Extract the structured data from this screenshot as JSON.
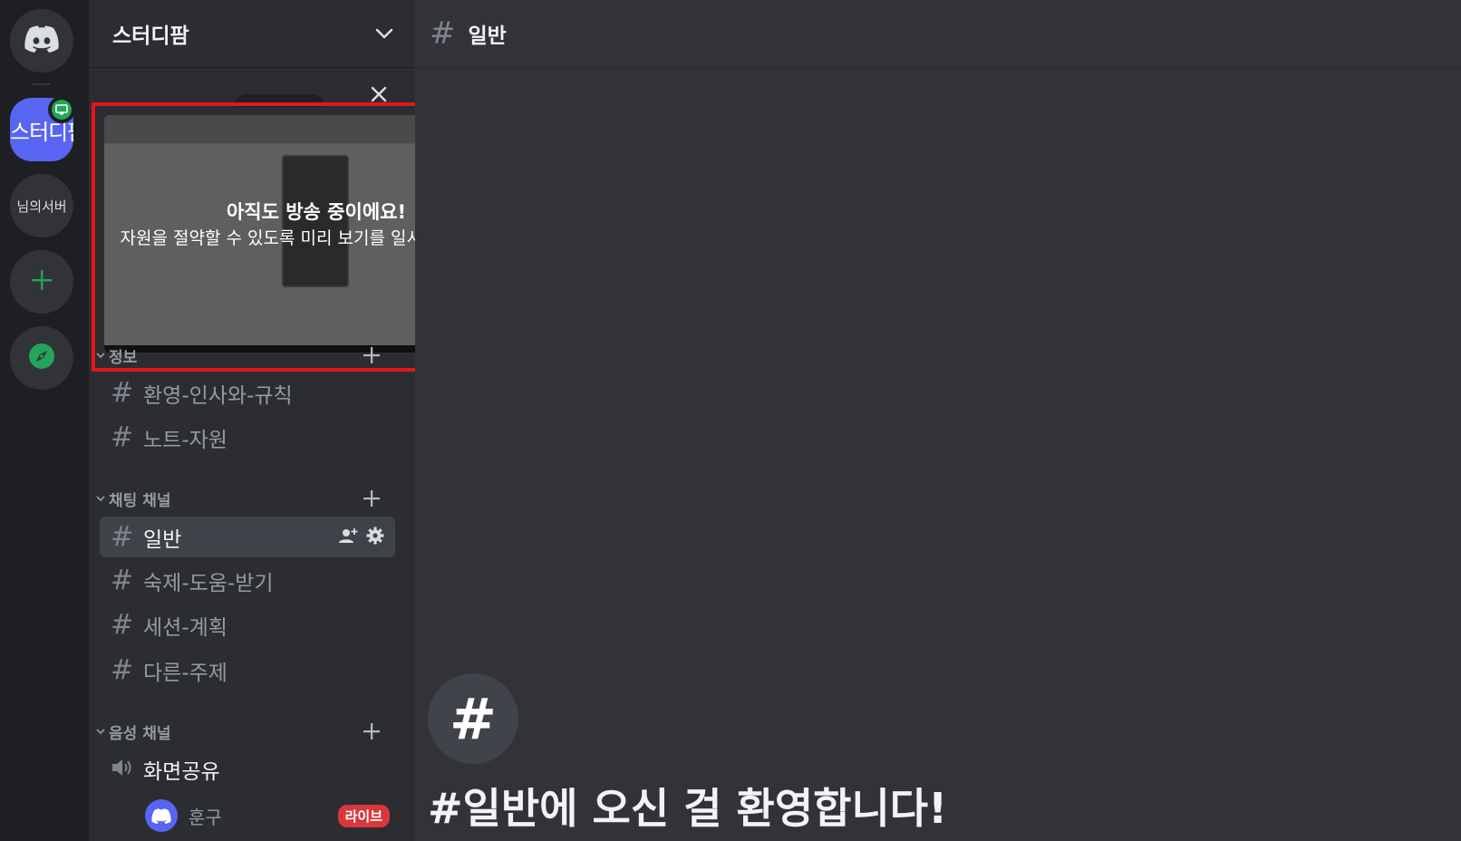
{
  "server": {
    "name": "스터디팜",
    "rail_active_label": "스터디팜",
    "rail_second_label": "님의서버"
  },
  "stream_preview": {
    "title": "아직도 방송 중이에요!",
    "subtitle": "자원을 절약할 수 있도록 미리 보기를 일시 정지했어요."
  },
  "categories": {
    "info": "정보",
    "chat": "채팅 채널",
    "voice": "음성 채널"
  },
  "channels": {
    "info": [
      "환영-인사와-규칙",
      "노트-자원"
    ],
    "chat": [
      "일반",
      "숙제-도움-받기",
      "세션-계획",
      "다른-주제"
    ],
    "voice": [
      "화면공유"
    ]
  },
  "channel_hash": "#",
  "voice_user": {
    "name": "훈구",
    "live": "라이브"
  },
  "main": {
    "channel_name": "일반",
    "welcome_icon": "#",
    "welcome_title": "#일반에 오신 걸 환영합니다!"
  },
  "colors": {
    "accent": "#5865f2",
    "online_green": "#23a55a",
    "live_red": "#da373c",
    "highlight_border": "#e3161b"
  },
  "icons": {
    "home": "discord-logo-icon",
    "add_server": "plus-icon",
    "explore": "compass-icon",
    "close": "close-icon",
    "invite": "add-member-icon",
    "settings": "gear-icon",
    "voice": "speaker-icon"
  }
}
